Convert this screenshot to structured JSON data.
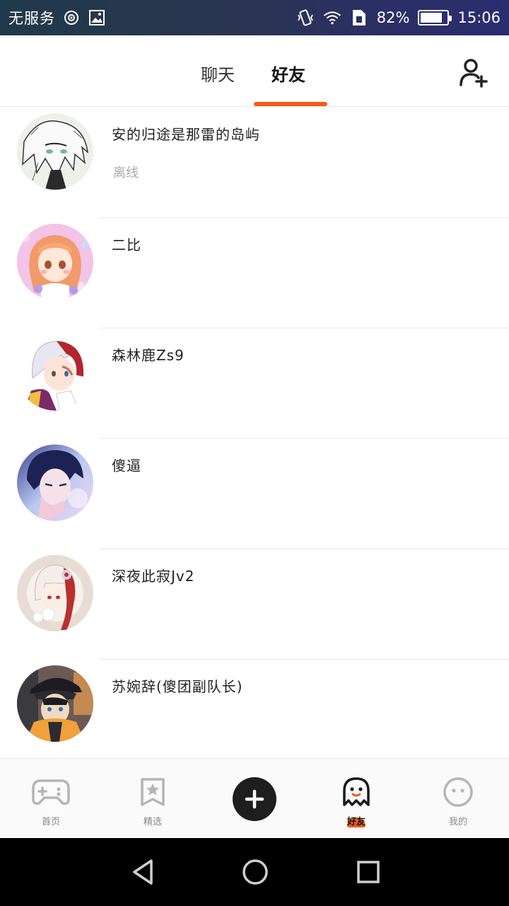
{
  "status_bar": {
    "carrier": "无服务",
    "battery_percent": "82%",
    "battery_level": 0.82,
    "time": "15:06",
    "icons": [
      "hotspot-icon",
      "image-icon",
      "vibrate-icon",
      "wifi-icon",
      "sim-icon",
      "battery-icon"
    ]
  },
  "header": {
    "tabs": [
      {
        "label": "聊天",
        "active": false
      },
      {
        "label": "好友",
        "active": true
      }
    ],
    "accent_color": "#f25a1a",
    "add_friend_icon": "add-person-icon"
  },
  "friends": [
    {
      "name": "安的归途是那雷的岛屿",
      "status": "离线"
    },
    {
      "name": "二比",
      "status": ""
    },
    {
      "name": "森林鹿Zs9",
      "status": ""
    },
    {
      "name": "傻逼",
      "status": ""
    },
    {
      "name": "深夜此寂Jv2",
      "status": ""
    },
    {
      "name": "苏婉辞(傻团副队长)",
      "status": ""
    }
  ],
  "bottom_nav": {
    "items": [
      {
        "label": "首页",
        "icon": "gamepad-icon",
        "active": false
      },
      {
        "label": "精选",
        "icon": "star-bookmark-icon",
        "active": false
      },
      {
        "label": "",
        "icon": "plus-icon",
        "active": false
      },
      {
        "label": "好友",
        "icon": "ghost-icon",
        "active": true
      },
      {
        "label": "我的",
        "icon": "face-icon",
        "active": false
      }
    ]
  },
  "system_nav": {
    "icons": [
      "back-icon",
      "home-icon",
      "recents-icon"
    ]
  }
}
